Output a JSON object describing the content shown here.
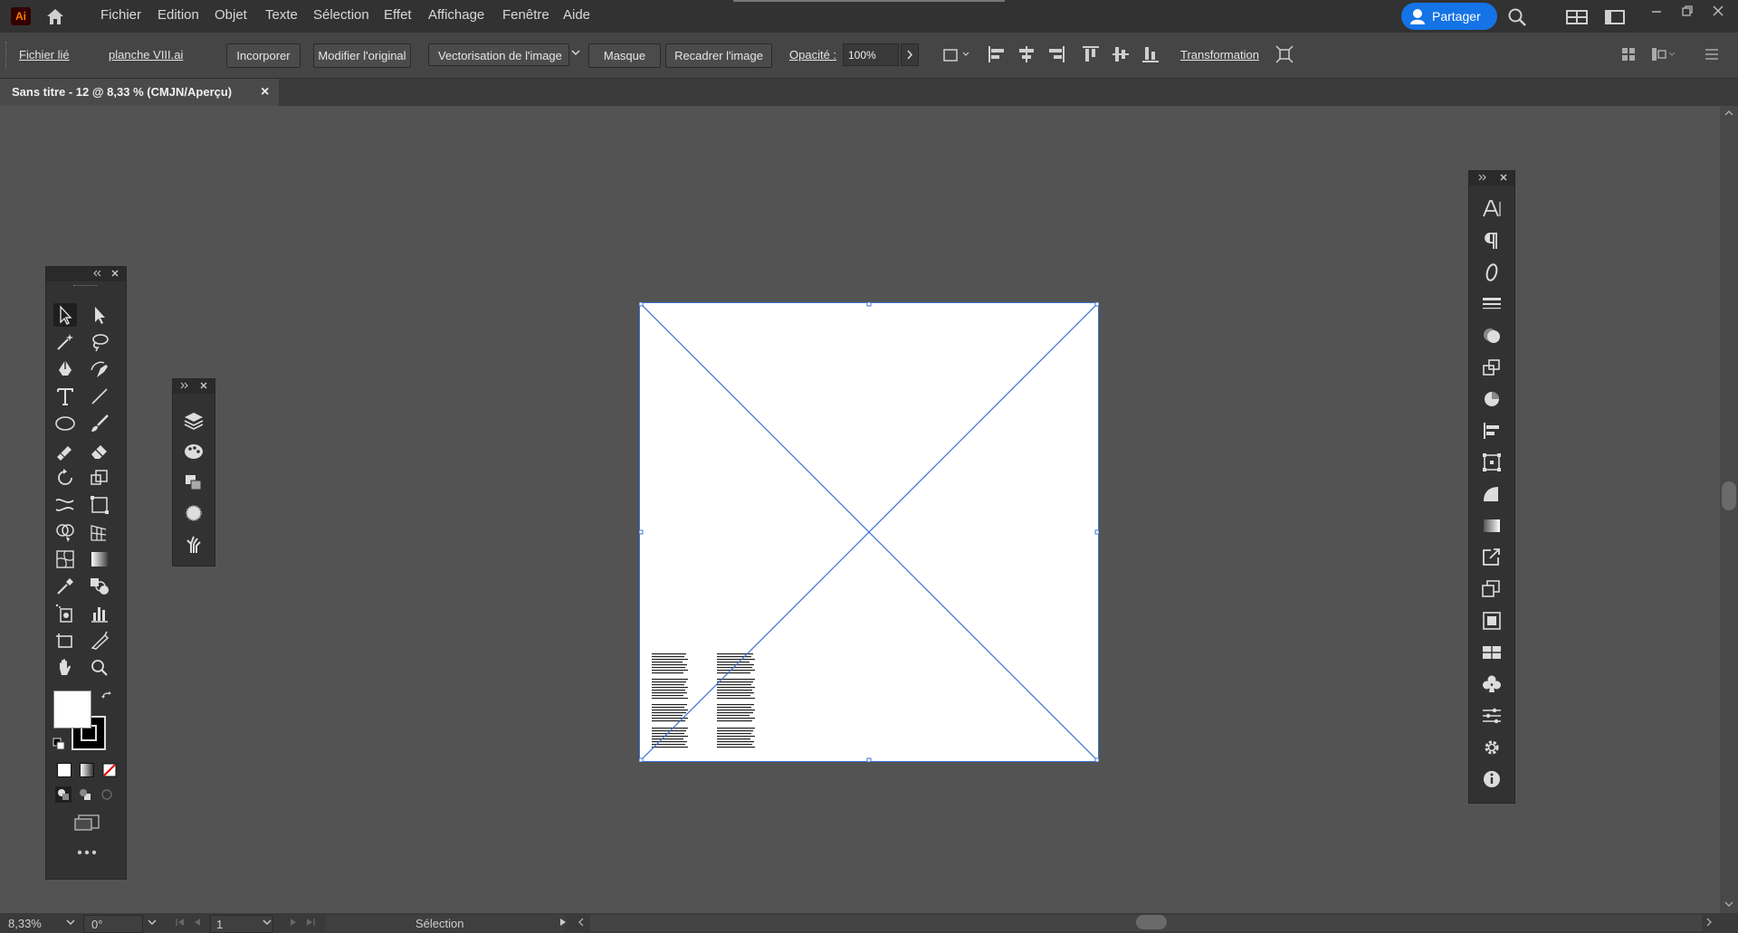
{
  "app": {
    "logo_text": "Ai"
  },
  "menus": [
    "Fichier",
    "Edition",
    "Objet",
    "Texte",
    "Sélection",
    "Effet",
    "Affichage",
    "Fenêtre",
    "Aide"
  ],
  "share_label": "Partager",
  "controlbar": {
    "linked_file": "Fichier lié",
    "file_name": "planche VIII.ai",
    "embed": "Incorporer",
    "edit_original": "Modifier l'original",
    "image_trace": "Vectorisation de l'image",
    "mask": "Masque",
    "crop_image": "Recadrer l'image",
    "opacity_label": "Opacité :",
    "opacity_value": "100%",
    "transform": "Transformation"
  },
  "document_tab": {
    "title": "Sans titre - 12 @ 8,33 % (CMJN/Aperçu)",
    "close": "×"
  },
  "statusbar": {
    "zoom": "8,33%",
    "rotation": "0°",
    "artboard": "1",
    "tool": "Sélection"
  },
  "colors": {
    "accent": "#1473e6",
    "selection": "#3b73d4",
    "background": "#535353"
  }
}
